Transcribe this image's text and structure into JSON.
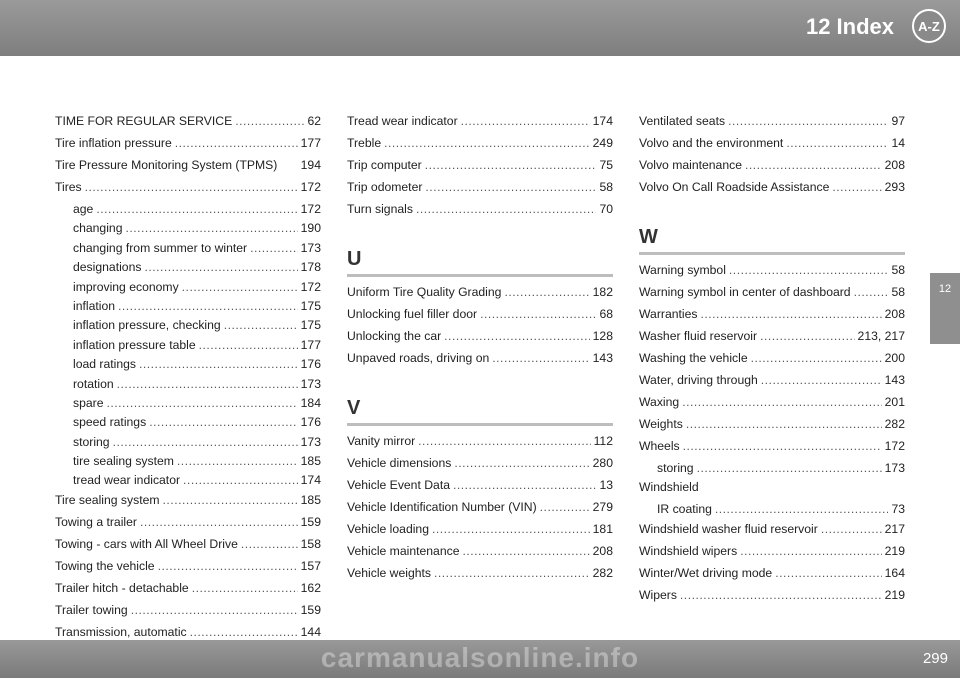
{
  "header": {
    "title": "12 Index",
    "icon_label": "A-Z"
  },
  "side_tab": {
    "label": "12"
  },
  "footer": {
    "page_number": "299",
    "watermark": "carmanualsonline.info"
  },
  "columns": [
    {
      "entries": [
        {
          "label": "TIME FOR REGULAR SERVICE",
          "page": "62"
        },
        {
          "label": "Tire inflation pressure",
          "page": "177"
        },
        {
          "label": "Tire Pressure Monitoring System (TPMS)",
          "page": "194",
          "nodots": true
        },
        {
          "label": "Tires",
          "page": "172"
        },
        {
          "label": "age",
          "page": "172",
          "sub": true
        },
        {
          "label": "changing",
          "page": "190",
          "sub": true
        },
        {
          "label": "changing from summer to winter",
          "page": "173",
          "sub": true
        },
        {
          "label": "designations",
          "page": "178",
          "sub": true
        },
        {
          "label": "improving economy",
          "page": "172",
          "sub": true
        },
        {
          "label": "inflation",
          "page": "175",
          "sub": true
        },
        {
          "label": "inflation pressure, checking",
          "page": "175",
          "sub": true
        },
        {
          "label": "inflation pressure table",
          "page": "177",
          "sub": true
        },
        {
          "label": "load ratings",
          "page": "176",
          "sub": true
        },
        {
          "label": "rotation",
          "page": "173",
          "sub": true
        },
        {
          "label": "spare",
          "page": "184",
          "sub": true
        },
        {
          "label": "speed ratings",
          "page": "176",
          "sub": true
        },
        {
          "label": "storing",
          "page": "173",
          "sub": true
        },
        {
          "label": "tire sealing system",
          "page": "185",
          "sub": true
        },
        {
          "label": "tread wear indicator",
          "page": "174",
          "sub": true
        },
        {
          "label": "Tire sealing system",
          "page": "185"
        },
        {
          "label": "Towing a trailer",
          "page": "159"
        },
        {
          "label": "Towing - cars with All Wheel Drive",
          "page": "158"
        },
        {
          "label": "Towing the vehicle",
          "page": "157"
        },
        {
          "label": "Trailer hitch - detachable",
          "page": "162"
        },
        {
          "label": "Trailer towing",
          "page": "159"
        },
        {
          "label": "Transmission, automatic",
          "page": "144"
        }
      ]
    },
    {
      "sections": [
        {
          "letter": "",
          "entries": [
            {
              "label": "Tread wear indicator",
              "page": "174"
            },
            {
              "label": "Treble",
              "page": "249"
            },
            {
              "label": "Trip computer",
              "page": "75"
            },
            {
              "label": "Trip odometer",
              "page": "58"
            },
            {
              "label": "Turn signals",
              "page": "70"
            }
          ]
        },
        {
          "letter": "U",
          "entries": [
            {
              "label": "Uniform Tire Quality Grading",
              "page": "182"
            },
            {
              "label": "Unlocking fuel filler door",
              "page": "68"
            },
            {
              "label": "Unlocking the car",
              "page": "128"
            },
            {
              "label": "Unpaved roads, driving on",
              "page": "143"
            }
          ]
        },
        {
          "letter": "V",
          "entries": [
            {
              "label": "Vanity mirror",
              "page": "112"
            },
            {
              "label": "Vehicle dimensions",
              "page": "280"
            },
            {
              "label": "Vehicle Event Data",
              "page": "13"
            },
            {
              "label": "Vehicle Identification Number (VIN)",
              "page": "279"
            },
            {
              "label": "Vehicle loading",
              "page": "181"
            },
            {
              "label": "Vehicle maintenance",
              "page": "208"
            },
            {
              "label": "Vehicle weights",
              "page": "282"
            }
          ]
        }
      ]
    },
    {
      "sections": [
        {
          "letter": "",
          "entries": [
            {
              "label": "Ventilated seats",
              "page": "97"
            },
            {
              "label": "Volvo and the environment",
              "page": "14"
            },
            {
              "label": "Volvo maintenance",
              "page": "208"
            },
            {
              "label": "Volvo On Call Roadside Assistance",
              "page": "293"
            }
          ]
        },
        {
          "letter": "W",
          "entries": [
            {
              "label": "Warning symbol",
              "page": "58"
            },
            {
              "label": "Warning symbol in center of dashboard",
              "page": "58"
            },
            {
              "label": "Warranties",
              "page": "208"
            },
            {
              "label": "Washer fluid reservoir",
              "page": "213, 217"
            },
            {
              "label": "Washing the vehicle",
              "page": "200"
            },
            {
              "label": "Water, driving through",
              "page": "143"
            },
            {
              "label": "Waxing",
              "page": "201"
            },
            {
              "label": "Weights",
              "page": "282"
            },
            {
              "label": "Wheels",
              "page": "172"
            },
            {
              "label": "storing",
              "page": "173",
              "sub": true
            },
            {
              "label": "Windshield",
              "page": "",
              "nodots": true
            },
            {
              "label": "IR coating",
              "page": "73",
              "sub": true
            },
            {
              "label": "Windshield washer fluid reservoir",
              "page": "217"
            },
            {
              "label": "Windshield wipers",
              "page": "219"
            },
            {
              "label": "Winter/Wet driving mode",
              "page": "164"
            },
            {
              "label": "Wipers",
              "page": "219"
            }
          ]
        }
      ]
    }
  ]
}
